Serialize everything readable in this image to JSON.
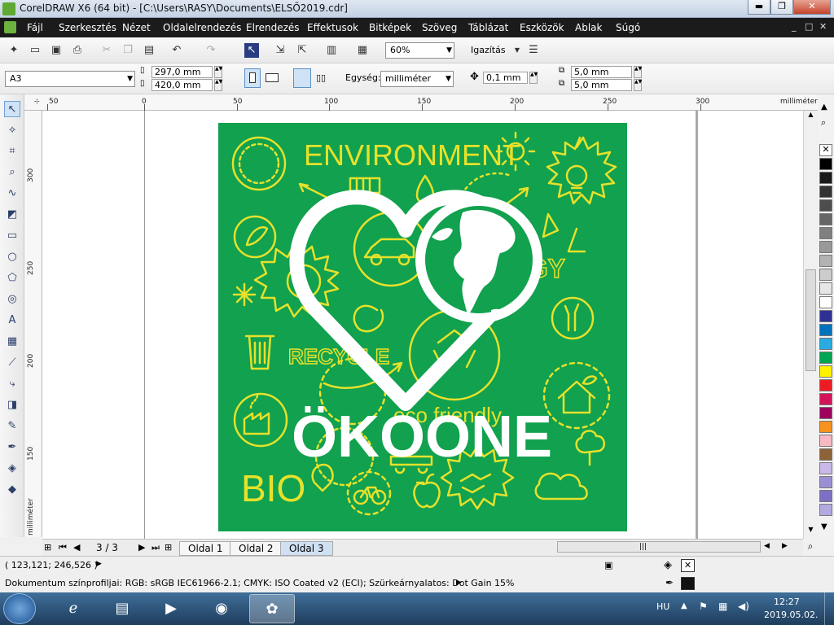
{
  "window": {
    "title": "CorelDRAW X6 (64 bit) - [C:\\Users\\RASY\\Documents\\ELSŐ2019.cdr]",
    "minimize_label": "▬",
    "maximize_label": "❐",
    "close_label": "✕"
  },
  "menu": {
    "items": [
      {
        "label": "Fájl"
      },
      {
        "label": "Szerkesztés"
      },
      {
        "label": "Nézet"
      },
      {
        "label": "Oldalelrendezés"
      },
      {
        "label": "Elrendezés"
      },
      {
        "label": "Effektusok"
      },
      {
        "label": "Bitképek"
      },
      {
        "label": "Szöveg"
      },
      {
        "label": "Táblázat"
      },
      {
        "label": "Eszközök"
      },
      {
        "label": "Ablak"
      },
      {
        "label": "Súgó"
      }
    ],
    "doc_controls": [
      "_",
      "□",
      "✕"
    ]
  },
  "toolbar": {
    "zoom": "60%",
    "snap_label": "Igazítás"
  },
  "property_bar": {
    "page_size": "A3",
    "width": "297,0 mm",
    "height": "420,0 mm",
    "units_label": "Egység:",
    "units": "milliméter",
    "nudge": "0,1 mm",
    "dup_x": "5,0 mm",
    "dup_y": "5,0 mm"
  },
  "ruler": {
    "h_ticks": [
      "50",
      "0",
      "50",
      "100",
      "150",
      "200",
      "250",
      "300"
    ],
    "h_unit": "milliméter",
    "v_ticks": [
      "300",
      "250",
      "200",
      "150"
    ],
    "v_unit": "milliméter"
  },
  "artwork": {
    "bg_color": "#11a14f",
    "line_color": "#e6e12b",
    "white": "#ffffff",
    "texts": {
      "environment": "ENVIRONMENT",
      "ecology": "ECOLOGY",
      "recycle": "RECYCLE",
      "eco_friendly": "eco friendly",
      "bio": "BIO",
      "logo": "ÖKOONE"
    }
  },
  "pages": {
    "counter": "3 / 3",
    "tabs": [
      {
        "label": "Oldal 1",
        "active": false
      },
      {
        "label": "Oldal 2",
        "active": false
      },
      {
        "label": "Oldal 3",
        "active": true
      }
    ]
  },
  "status": {
    "coords": "( 123,121; 246,526 )",
    "profile": "Dokumentum színprofiljai: RGB: sRGB IEC61966-2.1; CMYK: ISO Coated v2 (ECI); Szürkeárnyalatos: Dot Gain 15%"
  },
  "palette": {
    "colors": [
      "#000000",
      "#1a1a1a",
      "#333333",
      "#4d4d4d",
      "#666666",
      "#808080",
      "#999999",
      "#b3b3b3",
      "#cccccc",
      "#e6e6e6",
      "#ffffff",
      "#2e3192",
      "#0071bc",
      "#29abe2",
      "#00a651",
      "#fff200",
      "#ed1c24",
      "#d4145a",
      "#9e005d",
      "#f7931e",
      "#f9b9c4",
      "#8c6239",
      "#c9b8e8",
      "#9b8fd3",
      "#7f6fc4",
      "#b3a9e0"
    ]
  },
  "taskbar": {
    "lang": "HU",
    "time": "12:27",
    "date": "2019.05.02."
  }
}
